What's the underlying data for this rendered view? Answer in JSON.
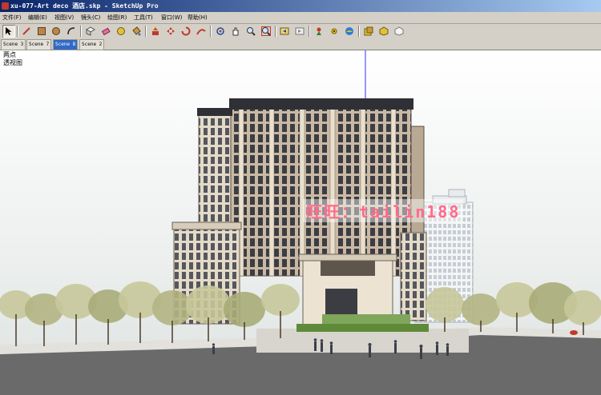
{
  "window": {
    "title": "xu-077-Art deco 酒店.skp - SketchUp Pro"
  },
  "menu": [
    "文件(F)",
    "编辑(E)",
    "视图(V)",
    "镜头(C)",
    "绘图(R)",
    "工具(T)",
    "窗口(W)",
    "帮助(H)"
  ],
  "toolbar": {
    "tools": [
      "select-tool",
      "line-tool",
      "rectangle-tool",
      "circle-tool",
      "arc-tool",
      "make-component-tool",
      "eraser-tool",
      "tape-measure-tool",
      "paint-bucket-tool",
      "push-pull-tool",
      "move-tool",
      "rotate-tool",
      "follow-me-tool",
      "orbit-tool",
      "pan-tool",
      "zoom-tool",
      "zoom-extents-tool",
      "previous-view-tool",
      "next-view-tool",
      "position-camera-tool",
      "look-around-tool",
      "walk-tool",
      "section-plane-tool",
      "get-models-tool",
      "share-model-tool"
    ]
  },
  "scenes": [
    {
      "label": "Scene 3",
      "active": false
    },
    {
      "label": "Scene 7",
      "active": false
    },
    {
      "label": "Scene 8",
      "active": true
    },
    {
      "label": "Scene 2",
      "active": false
    }
  ],
  "viewport": {
    "labels": [
      "两点",
      "透视图"
    ],
    "watermark": "旺旺：tailin188"
  }
}
